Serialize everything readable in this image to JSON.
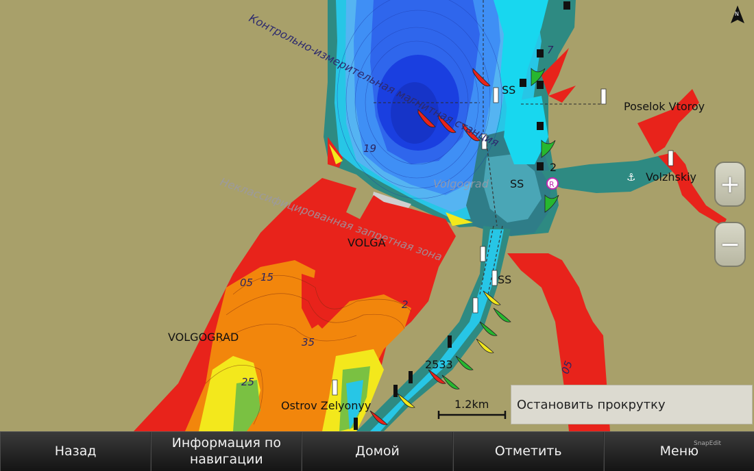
{
  "map": {
    "compass_label": "N",
    "places": {
      "poselok": "Poselok Vtoroy",
      "volzhskiy": "Volzhskiy",
      "volga": "VOLGA",
      "volgograd": "VOLGOGRAD",
      "ostrov": "Ostrov Zelyonyy",
      "volgograd_faint": "Volgograd"
    },
    "areas": {
      "magnetic_station": "Контрольно-измерительная магнитная станция",
      "restricted_zone": "Неклассифицированная запретная зона"
    },
    "depths": {
      "d19": "19",
      "d0_5": "05",
      "d1_5": "15",
      "d2": "2",
      "d3_5": "35",
      "d2_5": "25",
      "d0_5b": "05",
      "d7": "7"
    },
    "markers": {
      "ss1": "SS",
      "ss2": "SS",
      "ss3": "SS",
      "buoy_2": "2",
      "buoy_2533": "2533",
      "radio": "R"
    },
    "scale": {
      "label": "1.2km"
    }
  },
  "zoom": {
    "in_label": "+",
    "out_label": "−"
  },
  "stop_scroll_label": "Остановить прокрутку",
  "bottom_bar": {
    "back": "Назад",
    "nav_info": "Информация по навигации",
    "home": "Домой",
    "mark": "Отметить",
    "menu": "Меню"
  },
  "watermark": "SnapEdit",
  "colors": {
    "land": "#a8a06a",
    "red_zone": "#e8231b",
    "orange_zone": "#f2860c",
    "yellow_zone": "#f3e81c",
    "deep_blue": "#1a3fe0",
    "mid_blue": "#3f8ff5",
    "cyan": "#27d2ef",
    "teal": "#2e8a82"
  }
}
